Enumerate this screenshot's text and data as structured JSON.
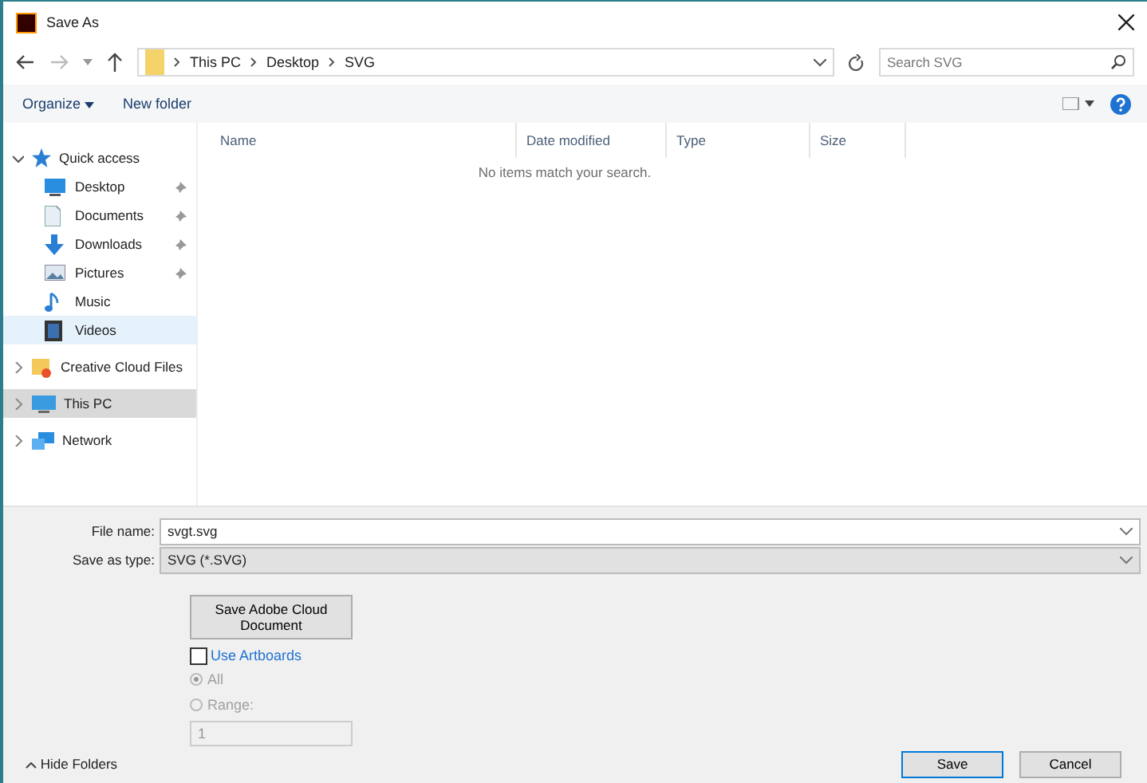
{
  "window": {
    "title": "Save As"
  },
  "address_bar": {
    "path": [
      "This PC",
      "Desktop",
      "SVG"
    ]
  },
  "search": {
    "placeholder": "Search SVG"
  },
  "toolbar": {
    "organize": "Organize",
    "new_folder": "New folder"
  },
  "nav_pane": {
    "items": [
      {
        "label": "Quick access",
        "kind": "star",
        "expanded": true,
        "focused": false,
        "children": [
          {
            "label": "Desktop",
            "kind": "desktop",
            "pinned": true,
            "selected": false
          },
          {
            "label": "Documents",
            "kind": "document",
            "pinned": true,
            "selected": false
          },
          {
            "label": "Downloads",
            "kind": "download",
            "pinned": true,
            "selected": false
          },
          {
            "label": "Pictures",
            "kind": "picture",
            "pinned": true,
            "selected": false
          },
          {
            "label": "Music",
            "kind": "music",
            "pinned": false,
            "selected": false
          },
          {
            "label": "Videos",
            "kind": "video",
            "pinned": false,
            "selected": true
          }
        ]
      },
      {
        "label": "Creative Cloud Files",
        "kind": "cloud-folder",
        "expanded": false,
        "focused": false
      },
      {
        "label": "This PC",
        "kind": "computer",
        "expanded": false,
        "focused": true
      },
      {
        "label": "Network",
        "kind": "network",
        "expanded": false,
        "focused": false
      }
    ]
  },
  "file_list": {
    "columns": [
      "Name",
      "Date modified",
      "Type",
      "Size"
    ],
    "empty_message": "No items match your search."
  },
  "form": {
    "file_name_label": "File name:",
    "file_name": "svgt.svg",
    "type_label": "Save as type:",
    "type": "SVG (*.SVG)"
  },
  "options": {
    "cloud_button": "Save Adobe Cloud Document",
    "use_artboards": {
      "label": "Use Artboards",
      "checked": false
    },
    "disabled": true,
    "radios": [
      {
        "label": "All",
        "selected": true
      },
      {
        "label": "Range:",
        "selected": false
      }
    ],
    "range_value": "1"
  },
  "footer": {
    "hide_folders": "Hide Folders",
    "buttons": [
      "Save",
      "Cancel"
    ]
  }
}
